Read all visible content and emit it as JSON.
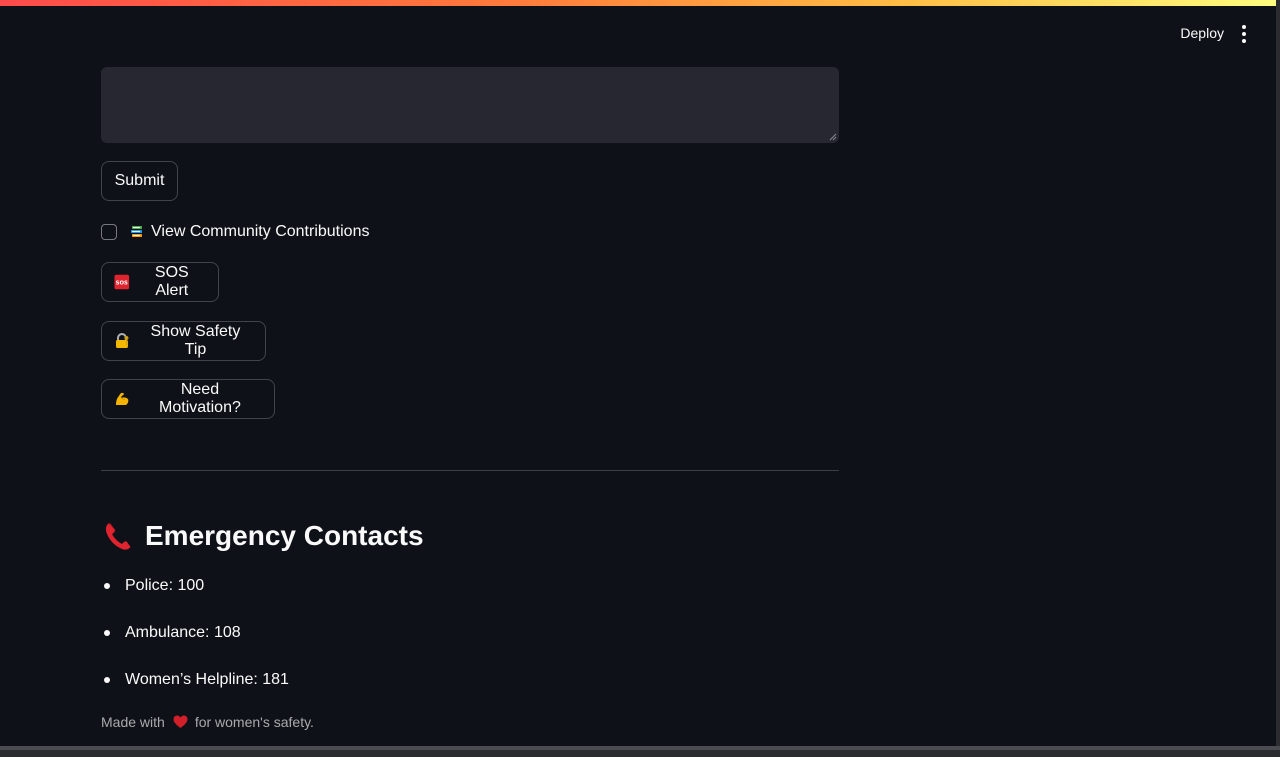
{
  "header": {
    "deploy_label": "Deploy"
  },
  "form": {
    "text_value": "",
    "submit_label": "Submit"
  },
  "community": {
    "checkbox_label": "View Community Contributions",
    "checked": false
  },
  "actions": {
    "sos_label": "SOS Alert",
    "tip_label": "Show Safety Tip",
    "motivation_label": "Need Motivation?"
  },
  "contacts": {
    "heading": "Emergency Contacts",
    "items": [
      {
        "label": "Police: 100"
      },
      {
        "label": "Ambulance: 108"
      },
      {
        "label": "Women’s Helpline: 181"
      }
    ]
  },
  "footer": {
    "prefix": "Made with",
    "suffix": "for women's safety."
  },
  "colors": {
    "background": "#0e1117",
    "input_background": "#262730",
    "text": "#fafafa",
    "accent_red": "#e0242f"
  },
  "icons": {
    "community": "books-icon",
    "sos": "sos-icon",
    "tip": "locked-with-key-icon",
    "motivation": "flexed-biceps-icon",
    "heading": "telephone-receiver-icon",
    "footer": "heart-icon",
    "menu": "vertical-ellipsis-icon"
  }
}
